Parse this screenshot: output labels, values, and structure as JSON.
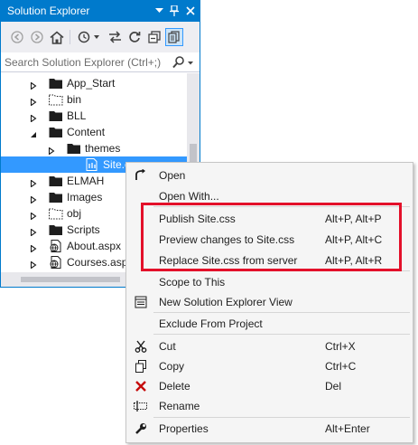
{
  "window": {
    "title": "Solution Explorer",
    "accent_color": "#007acc",
    "titlebar_buttons": [
      {
        "icon": "dropdown-arrow-icon"
      },
      {
        "icon": "pin-icon"
      },
      {
        "icon": "close-icon"
      }
    ]
  },
  "toolbar": {
    "buttons": [
      {
        "icon": "back-icon"
      },
      {
        "icon": "forward-icon"
      },
      {
        "icon": "home-icon"
      },
      {
        "icon": "pending-changes-filter-icon"
      },
      {
        "icon": "sync-with-active-document-icon"
      },
      {
        "icon": "refresh-icon"
      },
      {
        "icon": "collapse-all-icon"
      },
      {
        "icon": "show-all-files-icon"
      }
    ]
  },
  "search": {
    "placeholder": "Search Solution Explorer (Ctrl+;)",
    "icon": "search-icon"
  },
  "tree": {
    "items": [
      {
        "label": "App_Start",
        "icon": "folder-icon",
        "expander": "collapsed"
      },
      {
        "label": "bin",
        "icon": "folder-hidden-icon",
        "expander": "collapsed"
      },
      {
        "label": "BLL",
        "icon": "folder-icon",
        "expander": "collapsed"
      },
      {
        "label": "Content",
        "icon": "folder-icon",
        "expander": "expanded"
      },
      {
        "label": "themes",
        "icon": "folder-icon",
        "expander": "collapsed"
      },
      {
        "label": "Site.css",
        "icon": "css-file-icon",
        "expander": "none",
        "selected": true
      },
      {
        "label": "ELMAH",
        "icon": "folder-icon",
        "expander": "collapsed"
      },
      {
        "label": "Images",
        "icon": "folder-icon",
        "expander": "collapsed"
      },
      {
        "label": "obj",
        "icon": "folder-hidden-icon",
        "expander": "collapsed"
      },
      {
        "label": "Scripts",
        "icon": "folder-icon",
        "expander": "collapsed"
      },
      {
        "label": "About.aspx",
        "icon": "aspx-file-icon",
        "expander": "collapsed"
      },
      {
        "label": "Courses.aspx",
        "icon": "aspx-file-icon",
        "expander": "collapsed"
      }
    ]
  },
  "context_menu": {
    "items": [
      {
        "label": "Open",
        "shortcut": "",
        "icon": "open-icon"
      },
      {
        "label": "Open With...",
        "shortcut": "",
        "icon": ""
      },
      {
        "label": "Publish Site.css",
        "shortcut": "Alt+P, Alt+P",
        "icon": ""
      },
      {
        "label": "Preview changes to Site.css",
        "shortcut": "Alt+P, Alt+C",
        "icon": ""
      },
      {
        "label": "Replace Site.css from server",
        "shortcut": "Alt+P, Alt+R",
        "icon": ""
      },
      {
        "label": "Scope to This",
        "shortcut": "",
        "icon": ""
      },
      {
        "label": "New Solution Explorer View",
        "shortcut": "",
        "icon": "new-view-icon"
      },
      {
        "label": "Exclude From Project",
        "shortcut": "",
        "icon": ""
      },
      {
        "label": "Cut",
        "shortcut": "Ctrl+X",
        "icon": "cut-icon"
      },
      {
        "label": "Copy",
        "shortcut": "Ctrl+C",
        "icon": "copy-icon"
      },
      {
        "label": "Delete",
        "shortcut": "Del",
        "icon": "delete-icon"
      },
      {
        "label": "Rename",
        "shortcut": "",
        "icon": "rename-icon"
      },
      {
        "label": "Properties",
        "shortcut": "Alt+Enter",
        "icon": "properties-icon"
      }
    ],
    "highlight_color": "#e3102a"
  }
}
